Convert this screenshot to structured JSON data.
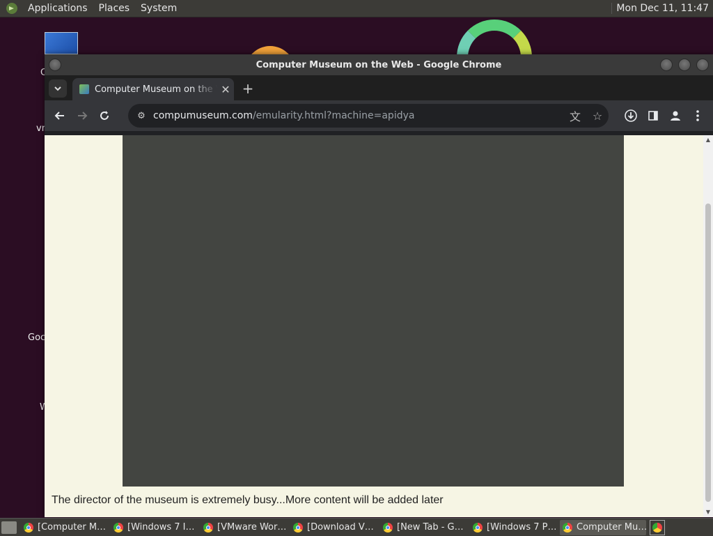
{
  "top_panel": {
    "menus": [
      "Applications",
      "Places",
      "System"
    ],
    "clock": "Mon Dec 11, 11:47"
  },
  "desktop": {
    "labels": [
      "C",
      "vn",
      "Goc",
      "W"
    ]
  },
  "window": {
    "title": "Computer Museum on the Web - Google Chrome",
    "tab": {
      "title": "Computer Museum on the W",
      "favicon": "museum-favicon"
    },
    "url": {
      "host": "compumuseum.com",
      "path": "/emularity.html?machine=apidya"
    },
    "toolbar_icons": [
      "back-icon",
      "forward-icon",
      "reload-icon",
      "site-info-icon",
      "translate-icon",
      "bookmark-star-icon",
      "download-icon",
      "side-panel-icon",
      "profile-icon",
      "menu-kebab-icon"
    ]
  },
  "page": {
    "note": "The director of the museum is extremely busy...More content will be added later",
    "emulator_bg": "#434541",
    "page_bg": "#f6f5e4"
  },
  "taskbar": {
    "tasks": [
      {
        "label": "[Computer M…",
        "active": false
      },
      {
        "label": "[Windows 7 I…",
        "active": false
      },
      {
        "label": "[VMware Wor…",
        "active": false
      },
      {
        "label": "[Download V…",
        "active": false
      },
      {
        "label": "[New Tab - G…",
        "active": false
      },
      {
        "label": "[Windows 7 P…",
        "active": false
      },
      {
        "label": "Computer Mu…",
        "active": true
      }
    ]
  }
}
